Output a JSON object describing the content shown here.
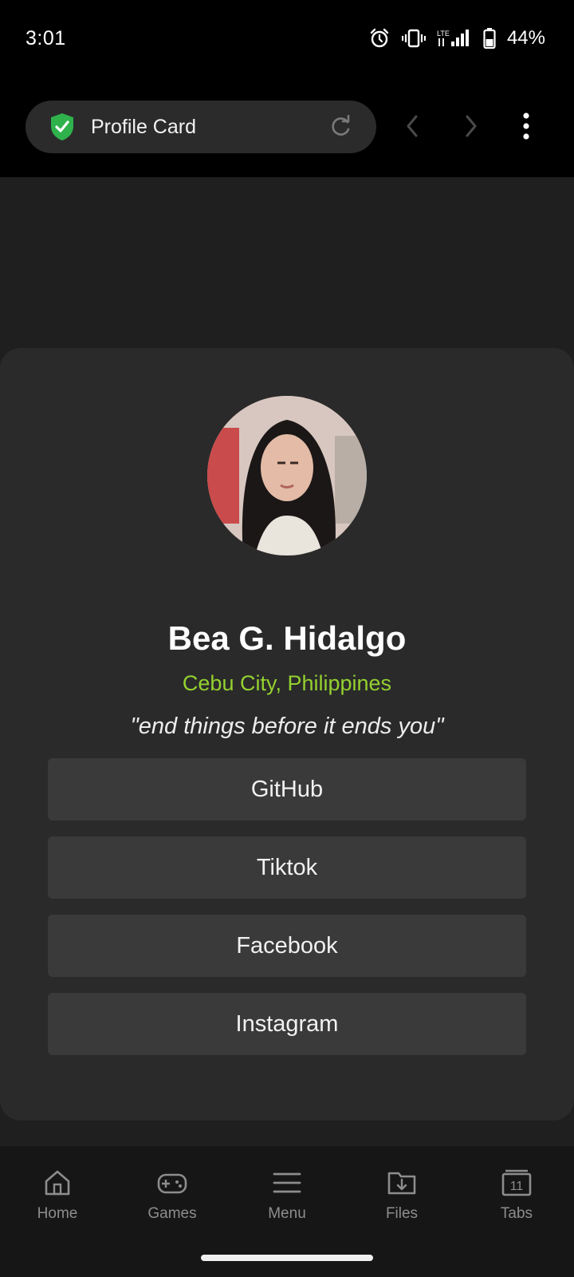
{
  "status_bar": {
    "time": "3:01",
    "battery": "44%",
    "icons": [
      "alarm-icon",
      "vibrate-icon",
      "lte-signal-icon",
      "battery-icon"
    ]
  },
  "browser": {
    "title": "Profile Card",
    "icons": [
      "shield-check-icon",
      "reload-icon",
      "back-icon",
      "forward-icon",
      "more-vertical-icon"
    ]
  },
  "profile": {
    "name": "Bea G. Hidalgo",
    "location": "Cebu City, Philippines",
    "quote": "\"end things before it ends you\"",
    "links": [
      {
        "label": "GitHub"
      },
      {
        "label": "Tiktok"
      },
      {
        "label": "Facebook"
      },
      {
        "label": "Instagram"
      }
    ]
  },
  "bottom_nav": {
    "items": [
      {
        "label": "Home",
        "icon": "home-icon"
      },
      {
        "label": "Games",
        "icon": "gamepad-icon"
      },
      {
        "label": "Menu",
        "icon": "menu-icon"
      },
      {
        "label": "Files",
        "icon": "folder-download-icon"
      },
      {
        "label": "Tabs",
        "icon": "tabs-icon",
        "count": "11"
      }
    ]
  },
  "colors": {
    "accent_location": "#94d12f",
    "shield": "#2fb24c",
    "card_bg": "#2a2a2a",
    "button_bg": "#3a3a3a"
  }
}
